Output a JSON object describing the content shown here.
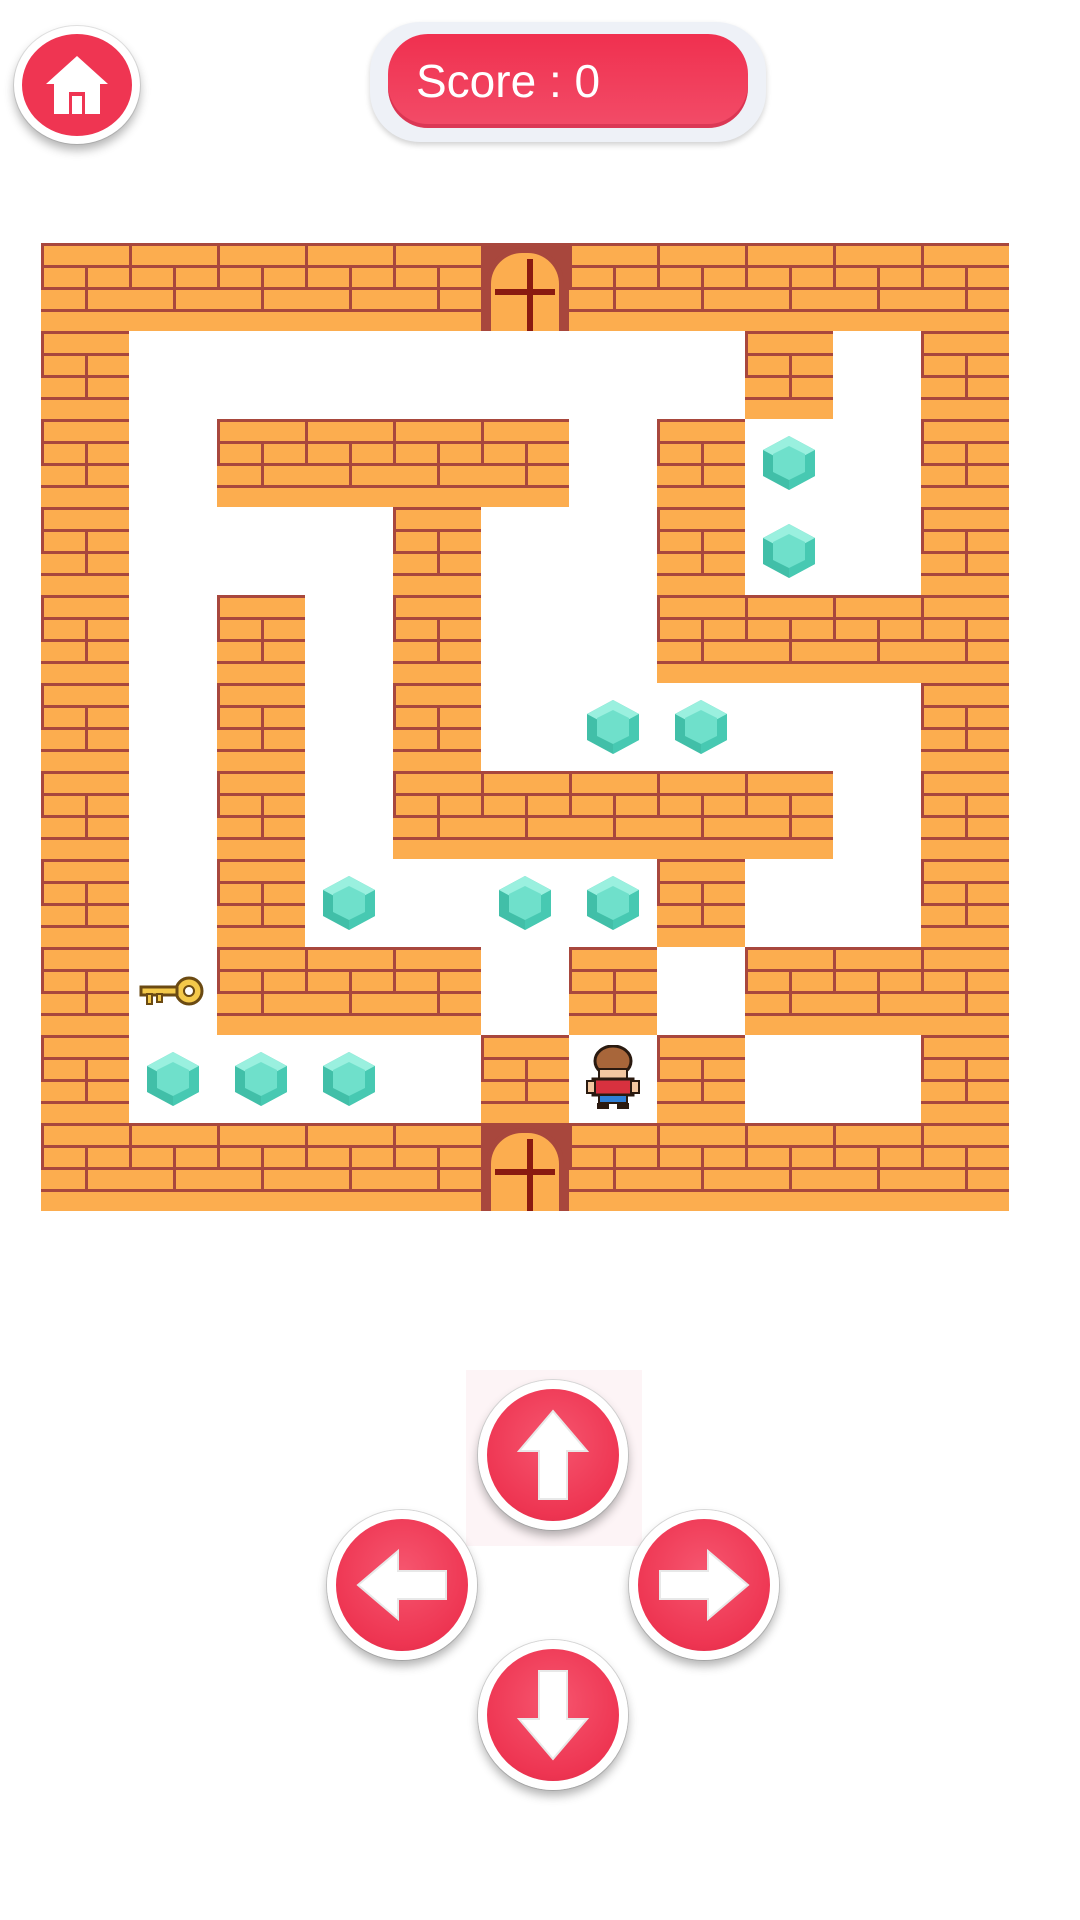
{
  "header": {
    "home_icon": "home-icon",
    "score_label": "Score : 0"
  },
  "maze": {
    "player_icon": "player-character-icon",
    "key_icon": "key-icon",
    "gem_icon": "gem-icon",
    "door_icon": "door-icon"
  },
  "controls": {
    "up_icon": "arrow-up-icon",
    "left_icon": "arrow-left-icon",
    "right_icon": "arrow-right-icon",
    "down_icon": "arrow-down-icon"
  },
  "colors": {
    "accent": "#ef3552",
    "brick": "#fcad4f",
    "mortar": "#a8473d",
    "gem": "#5fd6c0"
  }
}
